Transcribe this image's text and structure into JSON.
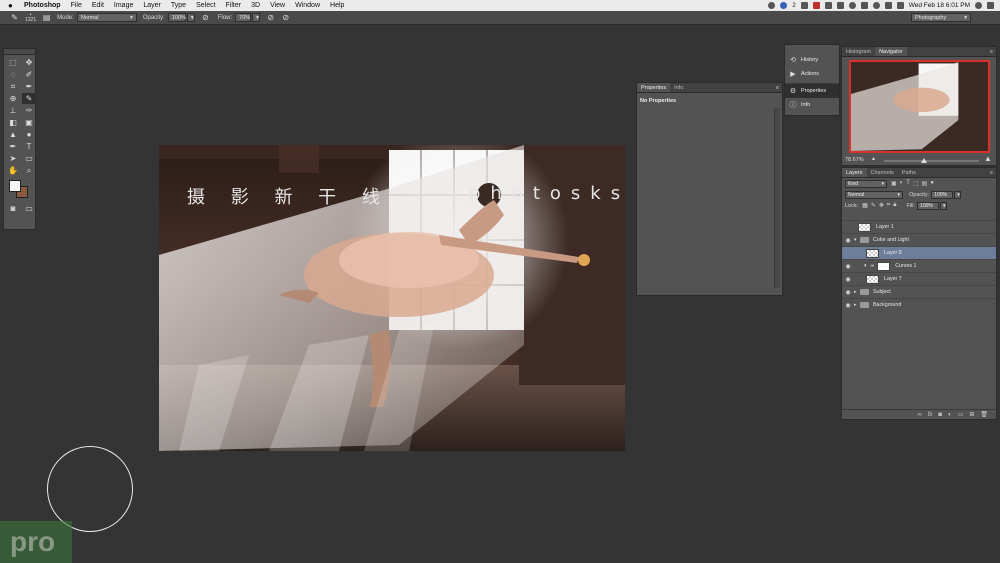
{
  "menubar": {
    "app_name": "Photoshop",
    "items": [
      "File",
      "Edit",
      "Image",
      "Layer",
      "Type",
      "Select",
      "Filter",
      "3D",
      "View",
      "Window",
      "Help"
    ],
    "clock": "Wed Feb 18  6:01 PM",
    "badge_count": "2"
  },
  "options": {
    "brush_size": "1321",
    "mode_label": "Mode:",
    "mode_value": "Normal",
    "opacity_label": "Opacity:",
    "opacity_value": "100%",
    "flow_label": "Flow:",
    "flow_value": "70%",
    "workspace": "Photography"
  },
  "canvas": {
    "watermark_left": "摄 影 新 干 线",
    "watermark_right": "photosks.vip"
  },
  "logo": {
    "text": "pro"
  },
  "properties_panel": {
    "tabs": [
      "Properties",
      "Info"
    ],
    "message": "No Properties"
  },
  "dock": {
    "items": [
      {
        "label": "History",
        "icon": "history-icon"
      },
      {
        "label": "Actions",
        "icon": "actions-icon"
      },
      {
        "label": "Properties",
        "icon": "properties-icon"
      },
      {
        "label": "Info",
        "icon": "info-icon"
      }
    ]
  },
  "navigator": {
    "tabs": [
      "Histogram",
      "Navigator"
    ],
    "zoom": "78.67%",
    "zoom_fraction": 0.42,
    "frame_color": "#d9302c"
  },
  "layers": {
    "tabs": [
      "Layers",
      "Channels",
      "Paths"
    ],
    "filter_kind": "Kind",
    "blend_mode": "Normal",
    "opacity_label": "Opacity:",
    "opacity_value": "100%",
    "lock_label": "Lock:",
    "fill_label": "Fill:",
    "fill_value": "100%",
    "rows": [
      {
        "name": "Layer 1"
      },
      {
        "name": "Color and Light"
      },
      {
        "name": "Layer 8"
      },
      {
        "name": "Curves 1"
      },
      {
        "name": "Layer 7"
      },
      {
        "name": "Subject"
      },
      {
        "name": "Background"
      }
    ],
    "selection_color": "#6c7e99"
  }
}
